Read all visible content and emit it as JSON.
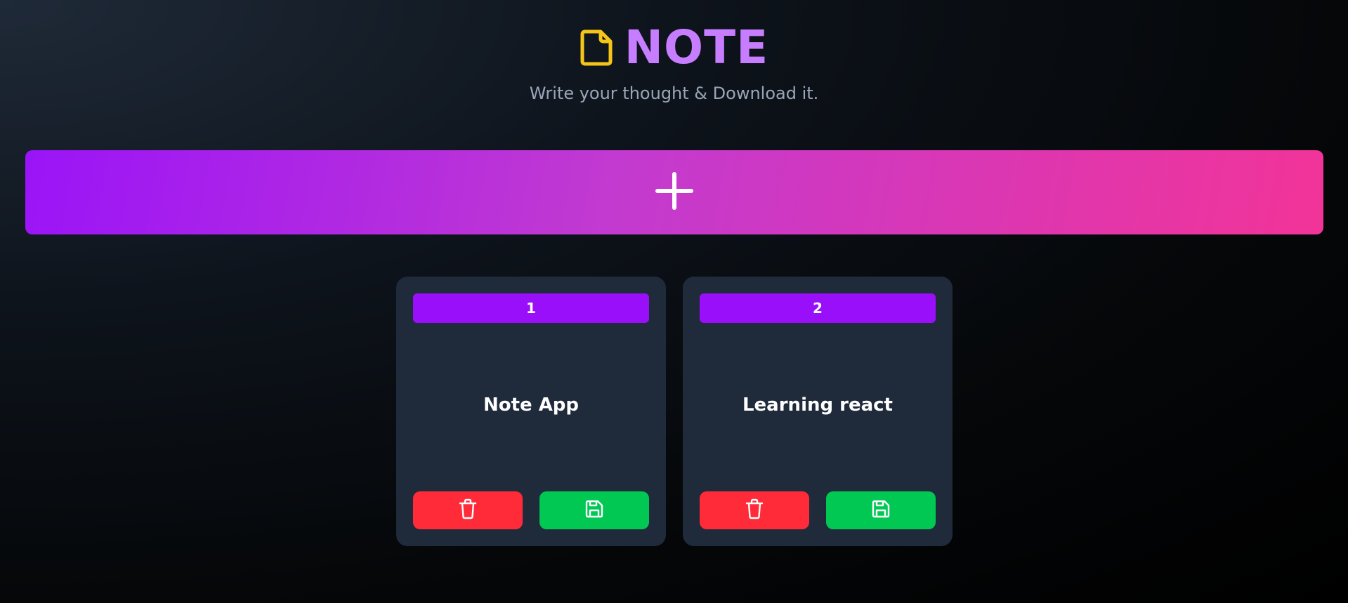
{
  "header": {
    "title": "NOTE",
    "subtitle": "Write your thought & Download it.",
    "icon": "file-icon"
  },
  "add_button": {
    "icon": "plus-icon"
  },
  "notes": [
    {
      "number": "1",
      "title": "Note App"
    },
    {
      "number": "2",
      "title": "Learning react"
    }
  ],
  "colors": {
    "title": "#c77dff",
    "file_icon": "#f5c518",
    "subtitle": "#9aa6b8",
    "add_gradient_start": "#9a14f8",
    "add_gradient_end": "#f23498",
    "card_background": "#1f2a3b",
    "note_badge": "#9a0ff9",
    "delete_button": "#ff2b38",
    "save_button": "#00c853"
  },
  "icons": {
    "delete": "trash-icon",
    "save": "floppy-disk-icon"
  }
}
